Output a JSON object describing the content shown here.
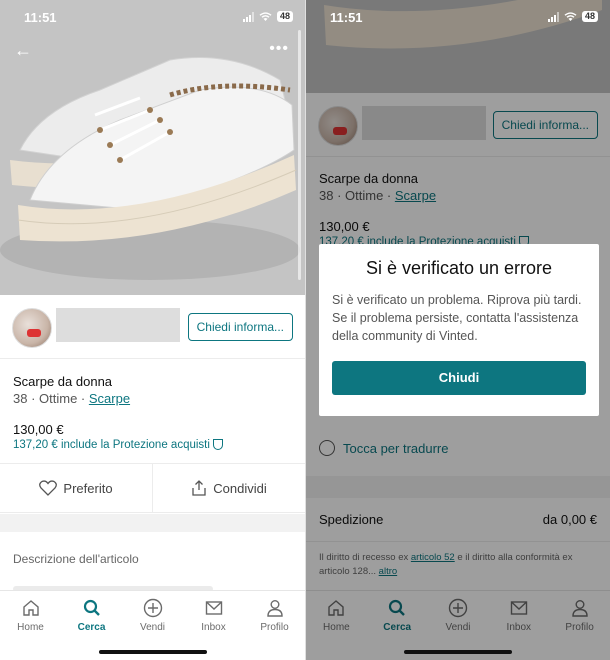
{
  "status_bar": {
    "time": "11:51",
    "battery": "48"
  },
  "listing": {
    "ask_button": "Chiedi informa...",
    "title": "Scarpe da donna",
    "meta_prefix": "38 · Ottime · ",
    "meta_link": "Scarpe",
    "price": "130,00 €",
    "protection": "137,20 € include la Protezione acquisti",
    "favorite_label": "Preferito",
    "share_label": "Condividi",
    "description_label": "Descrizione dell'articolo"
  },
  "translate_label": "Tocca per tradurre",
  "shipping": {
    "label": "Spedizione",
    "value": "da 0,00 €"
  },
  "legal": {
    "prefix": "Il diritto di recesso ex ",
    "link1": "articolo 52",
    "middle": " e il diritto alla conformità ex articolo 128... ",
    "link2": "altro"
  },
  "dialog": {
    "title": "Si è verificato un errore",
    "body": "Si è verificato un problema. Riprova più tardi. Se il problema persiste, contatta l'assistenza della community di Vinted.",
    "button": "Chiudi"
  },
  "tabs": [
    {
      "label": "Home",
      "icon": "home-icon"
    },
    {
      "label": "Cerca",
      "icon": "search-icon"
    },
    {
      "label": "Vendi",
      "icon": "plus-icon"
    },
    {
      "label": "Inbox",
      "icon": "inbox-icon"
    },
    {
      "label": "Profilo",
      "icon": "profile-icon"
    }
  ],
  "colors": {
    "accent": "#0d7680"
  }
}
